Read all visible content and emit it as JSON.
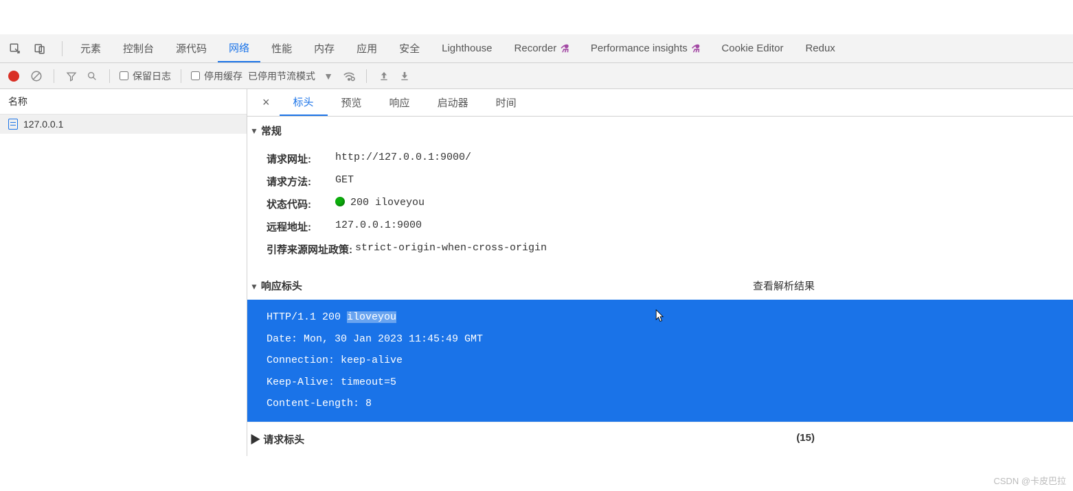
{
  "topTabs": {
    "elements": "元素",
    "console": "控制台",
    "sources": "源代码",
    "network": "网络",
    "performance": "性能",
    "memory": "内存",
    "application": "应用",
    "security": "安全",
    "lighthouse": "Lighthouse",
    "recorder": "Recorder",
    "perf_insights": "Performance insights",
    "cookie_editor": "Cookie Editor",
    "redux": "Redux"
  },
  "toolbar": {
    "preserveLog": "保留日志",
    "disableCache": "停用缓存",
    "throttling": "已停用节流模式"
  },
  "sidebar": {
    "nameHeader": "名称",
    "items": [
      {
        "label": "127.0.0.1"
      }
    ]
  },
  "detailTabs": {
    "headers": "标头",
    "preview": "预览",
    "response": "响应",
    "initiator": "启动器",
    "timing": "时间"
  },
  "general": {
    "title": "常规",
    "rows": {
      "url": {
        "k": "请求网址:",
        "v": "http://127.0.0.1:9000/"
      },
      "method": {
        "k": "请求方法:",
        "v": "GET"
      },
      "status": {
        "k": "状态代码:",
        "v": "200 iloveyou"
      },
      "remote": {
        "k": "远程地址:",
        "v": "127.0.0.1:9000"
      },
      "referrer": {
        "k": "引荐来源网址政策:",
        "v": "strict-origin-when-cross-origin"
      }
    }
  },
  "responseHeaders": {
    "title": "响应标头",
    "viewParsed": "查看解析结果",
    "raw": [
      {
        "pre": "HTTP/1.1 200 ",
        "hl": "iloveyou"
      },
      {
        "pre": "Date: Mon, 30 Jan 2023 11:45:49 GMT"
      },
      {
        "pre": "Connection: keep-alive"
      },
      {
        "pre": "Keep-Alive: timeout=5"
      },
      {
        "pre": "Content-Length: 8"
      }
    ]
  },
  "requestHeaders": {
    "title": "请求标头",
    "count": "(15)"
  },
  "watermark": "CSDN @卡皮巴拉"
}
